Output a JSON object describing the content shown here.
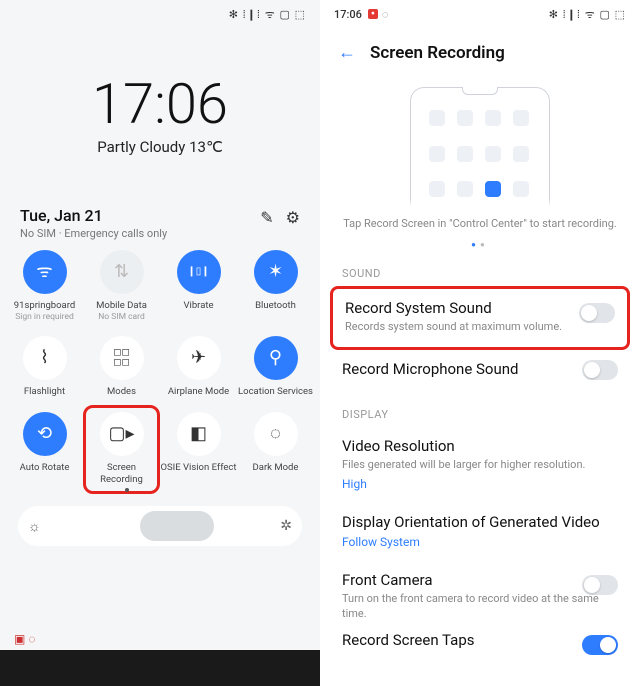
{
  "left": {
    "status_icons": "✻ ⁞❙⁞ ᯤ ▢ ⬚",
    "time": "17:06",
    "weather": "Partly Cloudy 13℃",
    "date": "Tue, Jan 21",
    "sim": "No SIM · Emergency calls only",
    "tiles": [
      {
        "icon": "ᯤ",
        "label": "91springboard",
        "sublabel": "Sign in required",
        "state": "active"
      },
      {
        "icon": "⇅",
        "label": "Mobile Data",
        "sublabel": "No SIM card",
        "state": "dim"
      },
      {
        "icon": "❙▯❙",
        "label": "Vibrate",
        "sublabel": "",
        "state": "active"
      },
      {
        "icon": "✶",
        "label": "Bluetooth",
        "sublabel": "",
        "state": "active"
      },
      {
        "icon": "⌇",
        "label": "Flashlight",
        "sublabel": "",
        "state": ""
      },
      {
        "icon": "◻◻\n◻◻",
        "label": "Modes",
        "sublabel": "",
        "state": ""
      },
      {
        "icon": "✈",
        "label": "Airplane Mode",
        "sublabel": "",
        "state": ""
      },
      {
        "icon": "⚲",
        "label": "Location Services",
        "sublabel": "",
        "state": "active"
      },
      {
        "icon": "⟲",
        "label": "Auto Rotate",
        "sublabel": "",
        "state": "active"
      },
      {
        "icon": "▢▸",
        "label": "Screen Recording",
        "sublabel": "",
        "state": "",
        "highlight": true
      },
      {
        "icon": "◧",
        "label": "OSIE Vision Effect",
        "sublabel": "",
        "state": ""
      },
      {
        "icon": "◌",
        "label": "Dark Mode",
        "sublabel": "",
        "state": ""
      }
    ],
    "bright_left": "☼",
    "bright_right": "✲"
  },
  "right": {
    "time": "17:06",
    "status_icons": "✻ ⁞❙⁞ ᯤ ▢ ⬚",
    "title": "Screen Recording",
    "hint": "Tap Record Screen in \"Control Center\" to start recording.",
    "section_sound": "SOUND",
    "row_sys_title": "Record System Sound",
    "row_sys_sub": "Records system sound at maximum volume.",
    "row_mic_title": "Record Microphone Sound",
    "section_display": "DISPLAY",
    "row_res_title": "Video Resolution",
    "row_res_sub": "Files generated will be larger for higher resolution.",
    "row_res_val": "High",
    "row_orient_title": "Display Orientation of Generated Video",
    "row_orient_val": "Follow System",
    "row_cam_title": "Front Camera",
    "row_cam_sub": "Turn on the front camera to record video at the same time.",
    "row_cut_title": "Record Screen Taps"
  }
}
